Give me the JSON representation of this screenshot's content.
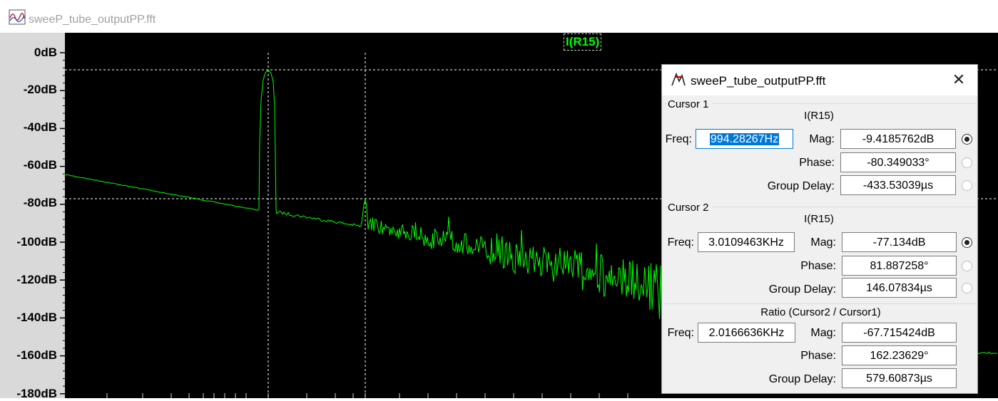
{
  "window": {
    "title": "sweeP_tube_outputPP.fft",
    "icon": "waveform-icon"
  },
  "plot": {
    "trace_label": "I(R15)",
    "y_ticks": [
      "0dB",
      "-20dB",
      "-40dB",
      "-60dB",
      "-80dB",
      "-100dB",
      "-120dB",
      "-140dB",
      "-160dB",
      "-180dB"
    ],
    "trace_color": "#00ff00",
    "background_color": "#000000"
  },
  "chart_data": {
    "type": "line",
    "title": "",
    "ylabel": "",
    "ylim": [
      -180,
      0
    ],
    "series": [
      {
        "name": "I(R15)",
        "color": "#00ff00"
      }
    ],
    "cursor1": {
      "mag_db": -9.4185762
    },
    "cursor2": {
      "mag_db": -77.134
    }
  },
  "dialog": {
    "title": "sweeP_tube_outputPP.fft",
    "close_label": "✕",
    "cursor1": {
      "group_label": "Cursor 1",
      "signal": "I(R15)",
      "freq_label": "Freq:",
      "freq_value": "994.28267Hz",
      "mag_label": "Mag:",
      "mag_value": "-9.4185762dB",
      "phase_label": "Phase:",
      "phase_value": "-80.349033°",
      "gd_label": "Group Delay:",
      "gd_value": "-433.53039µs"
    },
    "cursor2": {
      "group_label": "Cursor 2",
      "signal": "I(R15)",
      "freq_label": "Freq:",
      "freq_value": "3.0109463KHz",
      "mag_label": "Mag:",
      "mag_value": "-77.134dB",
      "phase_label": "Phase:",
      "phase_value": "81.887258°",
      "gd_label": "Group Delay:",
      "gd_value": "146.07834µs"
    },
    "ratio": {
      "group_label": "Ratio (Cursor2 / Cursor1)",
      "freq_label": "Freq:",
      "freq_value": "2.0166636KHz",
      "mag_label": "Mag:",
      "mag_value": "-67.715424dB",
      "phase_label": "Phase:",
      "phase_value": "162.23629°",
      "gd_label": "Group Delay:",
      "gd_value": "579.60873µs"
    }
  }
}
